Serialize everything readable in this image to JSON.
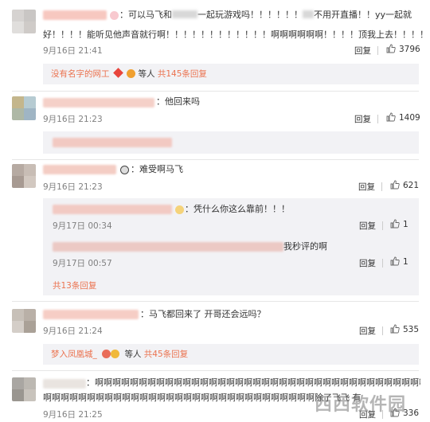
{
  "colors": {
    "link": "#eb7350",
    "time": "#808080",
    "subbg": "#f2f2f5"
  },
  "comments": [
    {
      "text_line1": "：可以马飞和",
      "text_line1b": "一起玩游戏吗！！！！！！",
      "text_line1c": "不用开直播！！yy一起就",
      "text_line2": "好！！！！能听见他声音就行啊！！！！！！！！！！！！啊啊啊啊啊啊！！！！顶我上去！！！！",
      "time": "9月16日 21:41",
      "reply": "回复",
      "likes": "3796",
      "sub_summary": {
        "user": "没有名字的网工",
        "suffix": "等人",
        "count": "共145条回复"
      }
    },
    {
      "text": "：他回来吗",
      "time": "9月16日 21:23",
      "reply": "回复",
      "likes": "1409"
    },
    {
      "text": "：难受啊马飞",
      "time": "9月16日 21:23",
      "reply": "回复",
      "likes": "621",
      "subs": [
        {
          "text": "：凭什么你这么靠前！！！",
          "time": "9月17日 00:34",
          "reply": "回复",
          "likes": "1"
        },
        {
          "text": "我秒评的啊",
          "time": "9月17日 00:57",
          "reply": "回复",
          "likes": "1"
        }
      ],
      "sub_more": "共13条回复"
    },
    {
      "text": "：马飞都回来了 开哥还会远吗？",
      "time": "9月16日 21:24",
      "reply": "回复",
      "likes": "535",
      "sub_summary": {
        "user": "梦入凤凰城_",
        "suffix": "等人",
        "count": "共45条回复"
      }
    },
    {
      "text_line1": "：啊啊啊啊啊啊啊啊啊啊啊啊啊啊啊啊啊啊啊啊啊啊啊啊啊啊啊啊啊啊啊啊啊啊啊啊啊啊啊啊啊",
      "text_line2": "啊啊啊啊啊啊啊啊啊啊啊啊啊啊啊啊啊啊啊啊啊啊啊啊啊啊啊啊啊啊啊除了飞飞 有",
      "time": "9月16日 21:25",
      "reply": "回复",
      "likes": "336"
    }
  ],
  "watermark": "西西软件园"
}
